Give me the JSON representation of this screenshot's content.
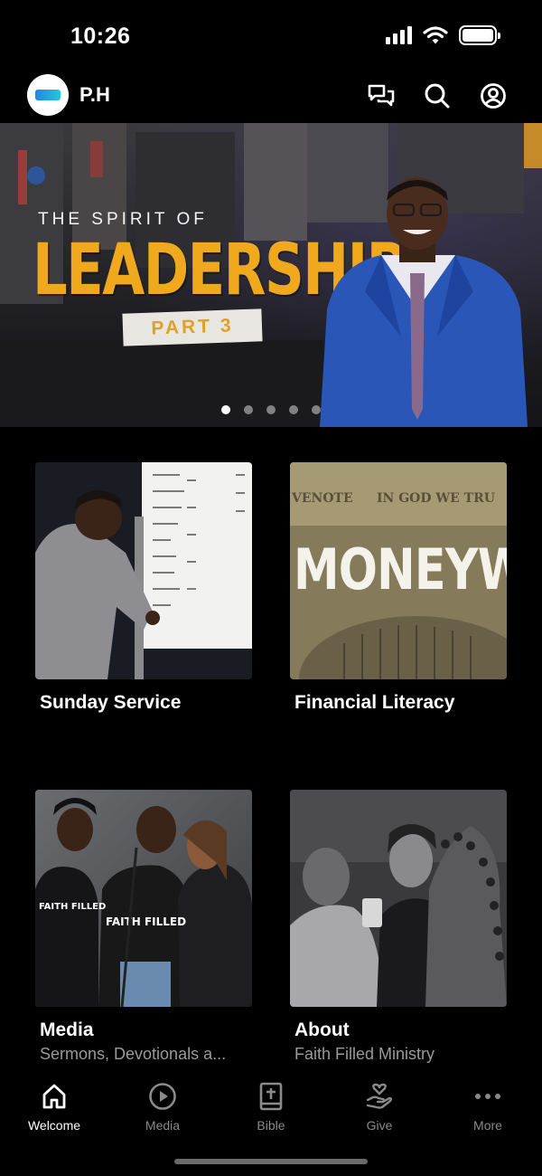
{
  "status_bar": {
    "time": "10:26"
  },
  "header": {
    "title": "P.H",
    "icons": [
      "chat-icon",
      "search-icon",
      "profile-icon"
    ]
  },
  "hero": {
    "line1": "THE SPIRIT OF",
    "line2": "LEADERSHIP",
    "line3": "PART 3",
    "slide_count": 5,
    "active_slide": 1
  },
  "cards": [
    {
      "title": "Sunday Service",
      "subtitle": ""
    },
    {
      "title": "Financial Literacy",
      "subtitle": "",
      "image_text": "MONEYW"
    },
    {
      "title": "Media",
      "subtitle": "Sermons, Devotionals a..."
    },
    {
      "title": "About",
      "subtitle": "Faith Filled Ministry"
    }
  ],
  "nav": [
    {
      "label": "Welcome",
      "icon": "home-icon",
      "active": true
    },
    {
      "label": "Media",
      "icon": "play-icon",
      "active": false
    },
    {
      "label": "Bible",
      "icon": "bible-icon",
      "active": false
    },
    {
      "label": "Give",
      "icon": "give-icon",
      "active": false
    },
    {
      "label": "More",
      "icon": "more-icon",
      "active": false
    }
  ],
  "colors": {
    "background": "#000000",
    "accent": "#f0a81c",
    "inactive": "#8a8a8a"
  }
}
